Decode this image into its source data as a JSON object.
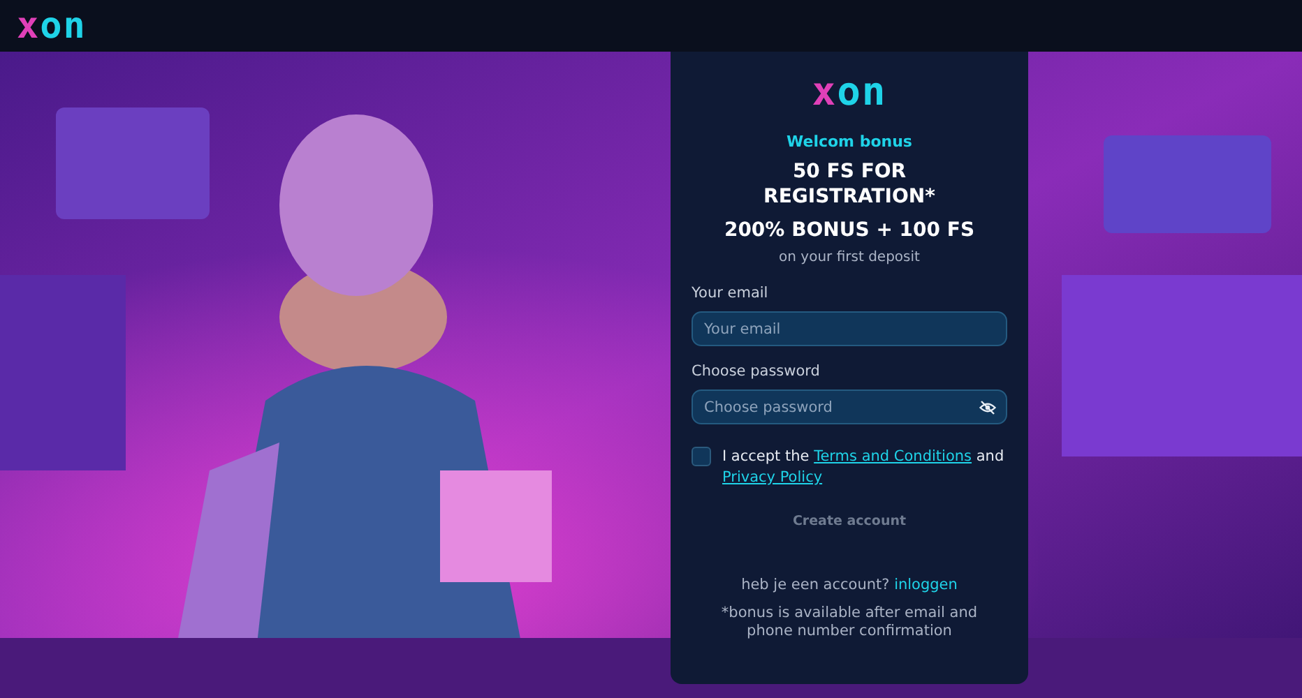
{
  "header": {
    "logo": {
      "x": "x",
      "rest": "on"
    }
  },
  "card": {
    "logo": {
      "x": "x",
      "rest": "on"
    },
    "bonus_label": "Welcom bonus",
    "headline_1": "50 FS FOR REGISTRATION*",
    "headline_2": "200% BONUS + 100 FS",
    "subline": "on your first deposit",
    "email": {
      "label": "Your email",
      "placeholder": "Your email"
    },
    "password": {
      "label": "Choose password",
      "placeholder": "Choose password",
      "visible": false
    },
    "terms": {
      "checked": false,
      "before": "I accept the",
      "link_1": "Terms and Conditions",
      "middle": "and",
      "link_2": "Privacy Policy"
    },
    "create_button": {
      "label": "Create account",
      "disabled": true
    },
    "login": {
      "question": "heb je een account?",
      "link": "inloggen"
    },
    "footnote": "*bonus is available after email and phone number confirmation"
  }
}
